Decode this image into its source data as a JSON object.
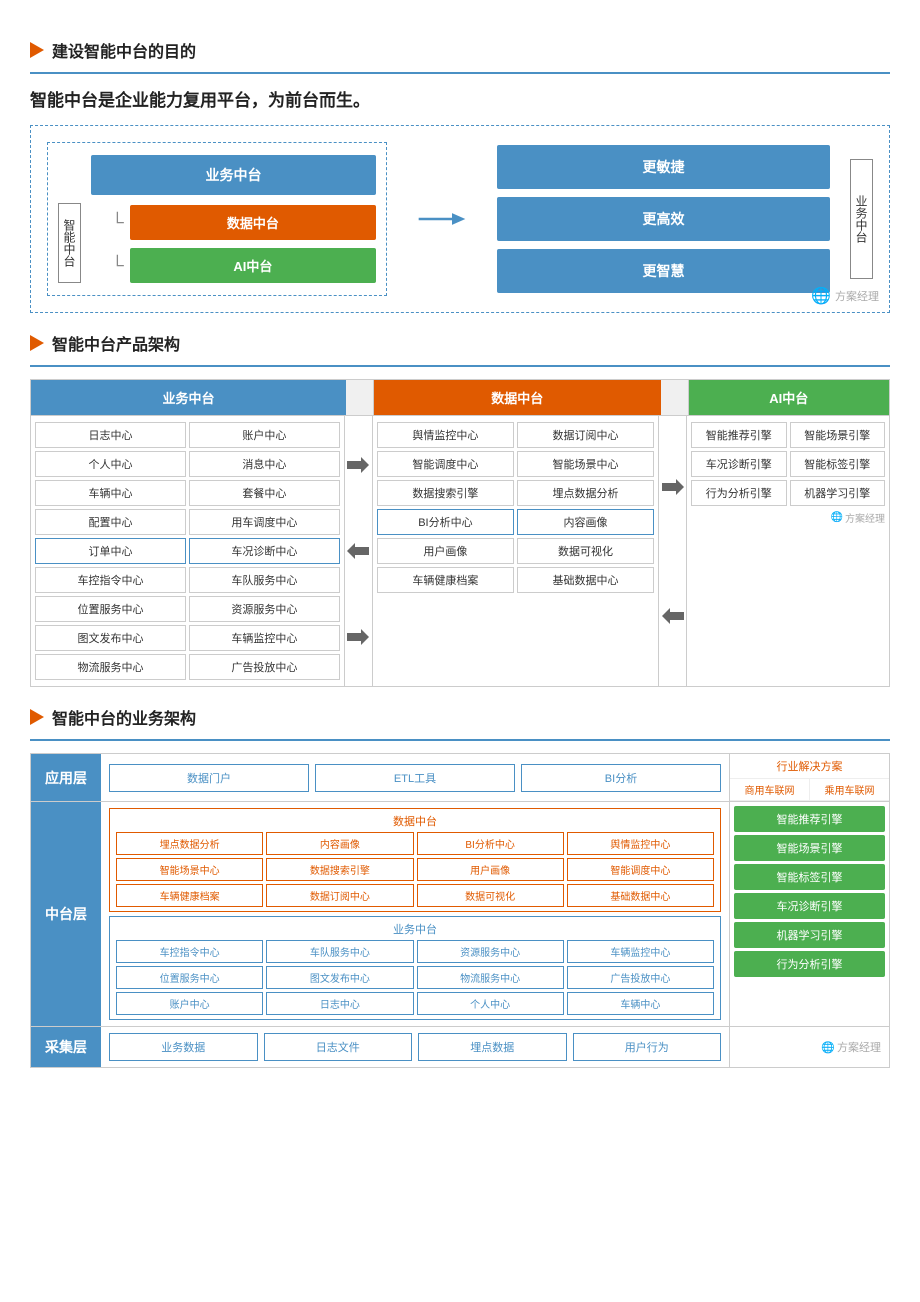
{
  "section1": {
    "header": "建设智能中台的目的",
    "subtitle_part1": "智能中台是企业",
    "subtitle_highlight": "能力复用平台",
    "subtitle_part2": "，为前台而生。",
    "left_label": "智能中台",
    "ywzt": "业务中台",
    "data_zt": "数据中台",
    "ai_zt": "AI中台",
    "result1": "更敏捷",
    "result2": "更高效",
    "result3": "更智慧",
    "right_label": "业务中台",
    "watermark": "方案经理"
  },
  "section2": {
    "header": "智能中台产品架构",
    "col1_header": "业务中台",
    "col2_header": "数据中台",
    "col3_header": "AI中台",
    "col1_items": [
      [
        "日志中心",
        "账户中心"
      ],
      [
        "个人中心",
        "消息中心"
      ],
      [
        "车辆中心",
        "套餐中心"
      ],
      [
        "配置中心",
        "用车调度中心"
      ],
      [
        "订单中心",
        "车况诊断中心"
      ],
      [
        "车控指令中心",
        "车队服务中心"
      ],
      [
        "位置服务中心",
        "资源服务中心"
      ],
      [
        "图文发布中心",
        "车辆监控中心"
      ],
      [
        "物流服务中心",
        "广告投放中心"
      ]
    ],
    "col2_items": [
      [
        "舆情监控中心",
        "数据订阅中心"
      ],
      [
        "智能调度中心",
        "智能场景中心"
      ],
      [
        "数据搜索引擎",
        "埋点数据分析"
      ],
      [
        "BI分析中心",
        "内容画像"
      ],
      [
        "用户画像",
        "数据可视化"
      ],
      [
        "车辆健康档案",
        "基础数据中心"
      ]
    ],
    "col3_items": [
      [
        "智能推荐引擎",
        "智能场景引擎"
      ],
      [
        "车况诊断引擎",
        "智能标签引擎"
      ],
      [
        "行为分析引擎",
        "机器学习引擎"
      ]
    ],
    "watermark": "方案经理"
  },
  "section3": {
    "header": "智能中台的业务架构",
    "row1_label": "应用层",
    "row1_items": [
      "数据门户",
      "ETL工具",
      "BI分析"
    ],
    "row1_right_header": "行业解决方案",
    "row1_right_sub1": "商用车联网",
    "row1_right_sub2": "乘用车联网",
    "row2_label": "中台层",
    "data_zt_label": "数据中台",
    "data_zt_items": [
      [
        "埋点数据分析",
        "内容画像",
        "BI分析中心",
        "舆情监控中心"
      ],
      [
        "智能场景中心",
        "数据搜索引擎",
        "用户画像",
        "智能调度中心"
      ],
      [
        "车辆健康档案",
        "数据订阅中心",
        "数据可视化",
        "基础数据中心"
      ]
    ],
    "yw_zt_label": "业务中台",
    "yw_zt_items": [
      [
        "车控指令中心",
        "车队服务中心",
        "资源服务中心",
        "车辆监控中心"
      ],
      [
        "位置服务中心",
        "图文发布中心",
        "物流服务中心",
        "广告投放中心"
      ],
      [
        "账户中心",
        "日志中心",
        "个人中心",
        "车辆中心"
      ]
    ],
    "ai_items": [
      "智能推荐引擎",
      "智能场景引擎",
      "智能标签引擎",
      "车况诊断引擎",
      "机器学习引擎",
      "行为分析引擎"
    ],
    "row3_label": "采集层",
    "row3_items": [
      "业务数据",
      "日志文件",
      "埋点数据",
      "用户行为"
    ],
    "watermark": "方案经理"
  }
}
